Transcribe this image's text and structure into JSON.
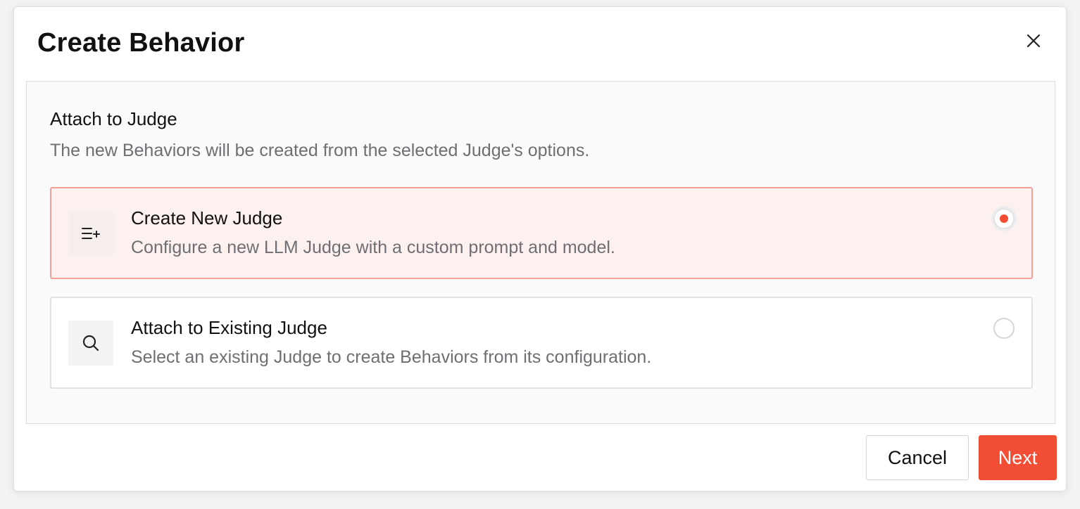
{
  "dialog": {
    "title": "Create Behavior",
    "close_icon": "close-icon"
  },
  "section": {
    "title": "Attach to Judge",
    "description": "The new Behaviors will be created from the selected Judge's options."
  },
  "options": [
    {
      "title": "Create New Judge",
      "description": "Configure a new LLM Judge with a custom prompt and model.",
      "icon": "list-add-icon",
      "selected": true
    },
    {
      "title": "Attach to Existing Judge",
      "description": "Select an existing Judge to create Behaviors from its configuration.",
      "icon": "search-icon",
      "selected": false
    }
  ],
  "footer": {
    "cancel_label": "Cancel",
    "next_label": "Next"
  },
  "colors": {
    "accent": "#f24e35",
    "selected_bg": "#fdf1ef",
    "selected_border": "#f2a095"
  }
}
